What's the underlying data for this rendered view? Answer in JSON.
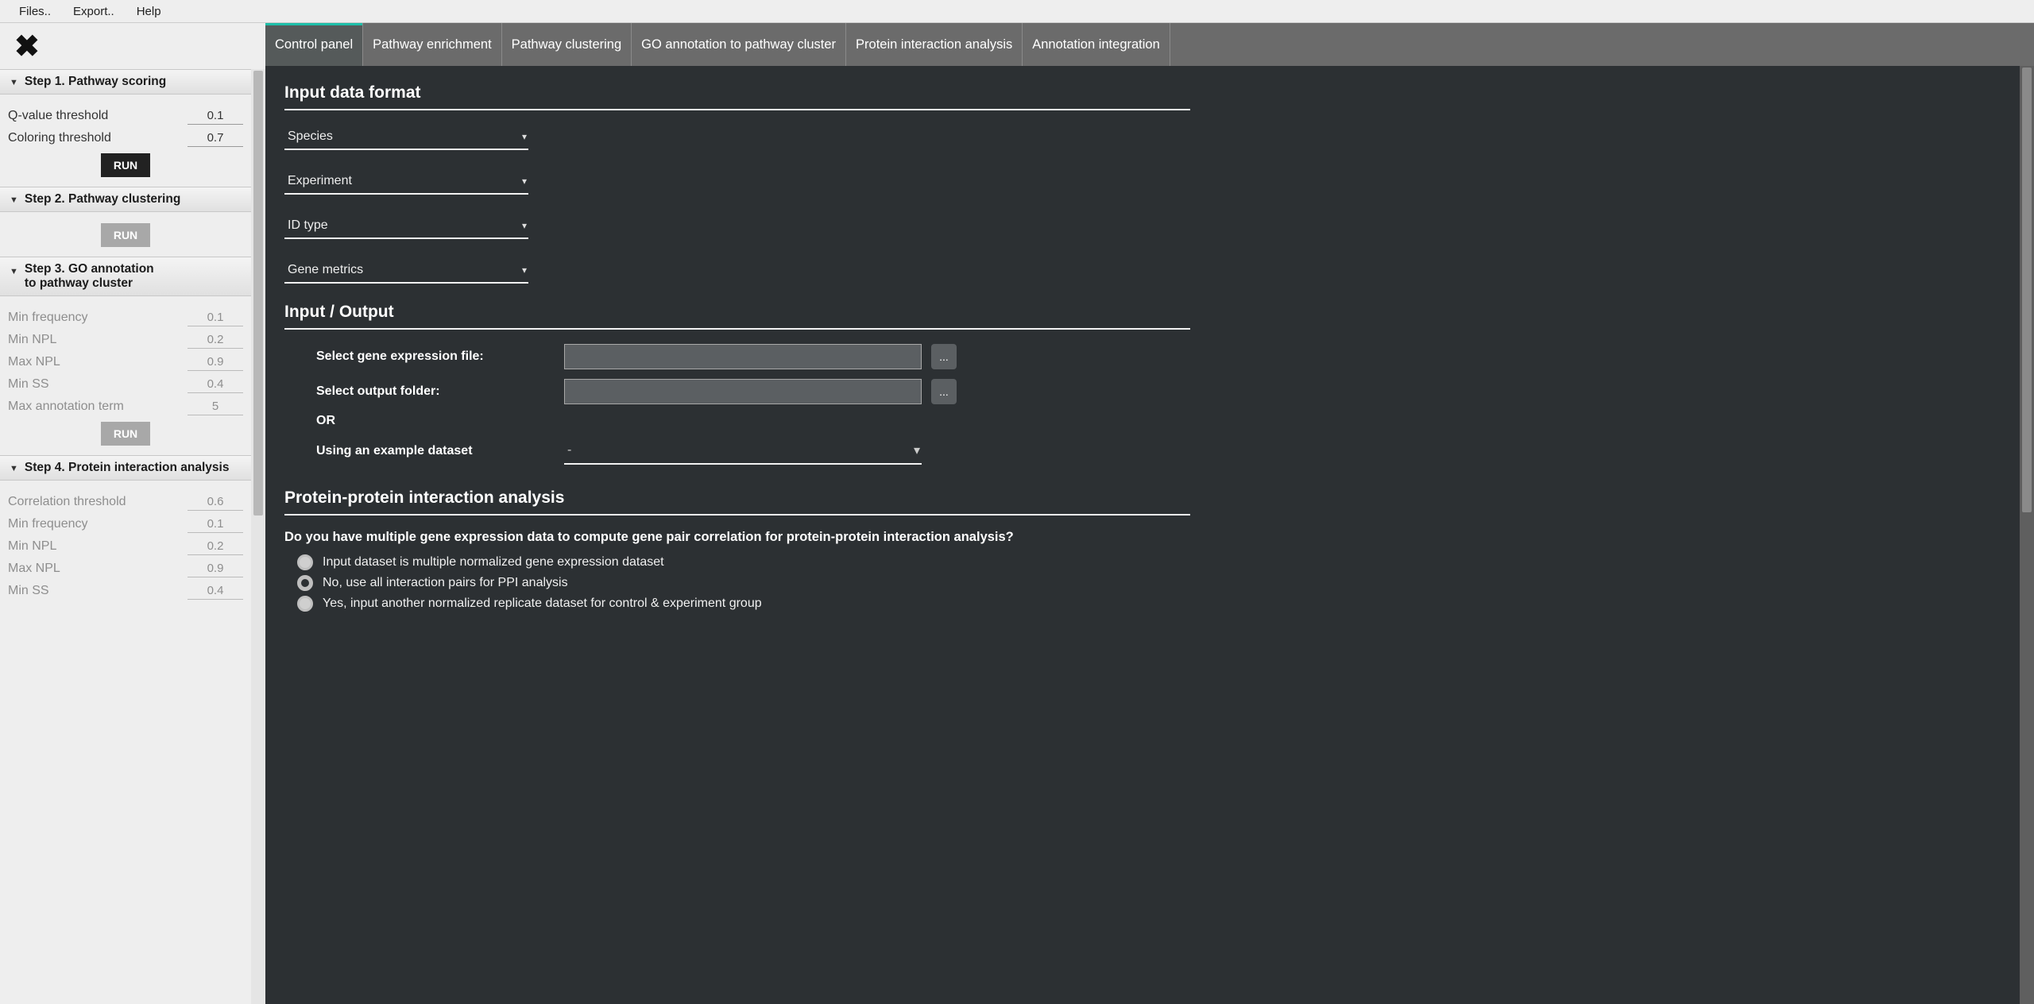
{
  "menu": {
    "files": "Files..",
    "export": "Export..",
    "help": "Help"
  },
  "tabs": {
    "control_panel": "Control panel",
    "pathway_enrichment": "Pathway enrichment",
    "pathway_clustering": "Pathway clustering",
    "go_annotation": "GO annotation to pathway cluster",
    "protein_interaction": "Protein interaction analysis",
    "annotation_integration": "Annotation integration"
  },
  "sidebar": {
    "step1": {
      "title": "Step 1. Pathway scoring",
      "qvalue_label": "Q-value threshold",
      "qvalue": "0.1",
      "coloring_label": "Coloring threshold",
      "coloring": "0.7",
      "run": "RUN"
    },
    "step2": {
      "title": "Step 2. Pathway clustering",
      "run": "RUN"
    },
    "step3": {
      "title_a": "Step 3. GO annotation",
      "title_b": "to pathway cluster",
      "min_freq_label": "Min frequency",
      "min_freq": "0.1",
      "min_npl_label": "Min NPL",
      "min_npl": "0.2",
      "max_npl_label": "Max NPL",
      "max_npl": "0.9",
      "min_ss_label": "Min SS",
      "min_ss": "0.4",
      "max_term_label": "Max annotation term",
      "max_term": "5",
      "run": "RUN"
    },
    "step4": {
      "title": "Step 4. Protein interaction analysis",
      "corr_label": "Correlation threshold",
      "corr": "0.6",
      "min_freq_label": "Min frequency",
      "min_freq": "0.1",
      "min_npl_label": "Min NPL",
      "min_npl": "0.2",
      "max_npl_label": "Max NPL",
      "max_npl": "0.9",
      "min_ss_label": "Min SS",
      "min_ss": "0.4"
    }
  },
  "main": {
    "input_format": {
      "heading": "Input data format",
      "species": "Species",
      "experiment": "Experiment",
      "id_type": "ID type",
      "gene_metrics": "Gene metrics"
    },
    "io": {
      "heading": "Input / Output",
      "select_file": "Select gene expression file:",
      "select_folder": "Select output folder:",
      "or": "OR",
      "example_label": "Using an example dataset",
      "example_value": "-",
      "browse": "..."
    },
    "ppi": {
      "heading": "Protein-protein interaction analysis",
      "question": "Do you have multiple gene expression data to compute gene pair correlation for protein-protein interaction analysis?",
      "opt1": "Input dataset is multiple normalized gene expression dataset",
      "opt2": "No, use all interaction pairs for PPI analysis",
      "opt3": "Yes, input another normalized replicate dataset for control & experiment group"
    }
  }
}
